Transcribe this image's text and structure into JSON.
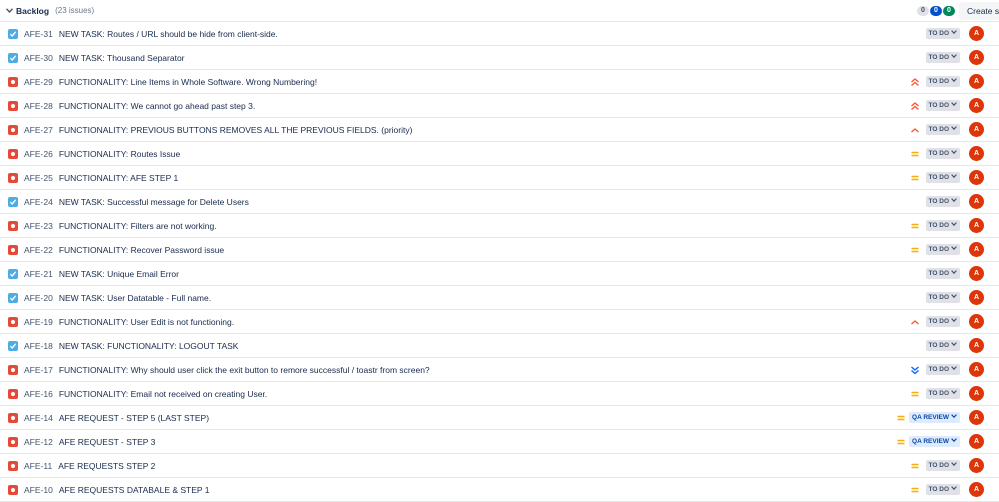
{
  "backlog": {
    "title": "Backlog",
    "count": "(23 issues)",
    "pills": [
      "0",
      "0",
      "0"
    ],
    "create_label": "Create sprint"
  },
  "colors": {
    "task": "#4bade8",
    "bug": "#e5493a",
    "priority_high": "#ff5630",
    "priority_medium": "#ffab00",
    "priority_low": "#0065ff",
    "avatar": "#de350b"
  },
  "issues": [
    {
      "type": "task",
      "key": "AFE-31",
      "summary": "NEW TASK: Routes / URL should be hide from client-side.",
      "priority": "none",
      "status": "TO DO",
      "avatar": "A"
    },
    {
      "type": "task",
      "key": "AFE-30",
      "summary": "NEW TASK: Thousand Separator",
      "priority": "none",
      "status": "TO DO",
      "avatar": "A"
    },
    {
      "type": "bug",
      "key": "AFE-29",
      "summary": "FUNCTIONALITY: Line Items in Whole Software. Wrong Numbering!",
      "priority": "highest",
      "status": "TO DO",
      "avatar": "A"
    },
    {
      "type": "bug",
      "key": "AFE-28",
      "summary": "FUNCTIONALITY: We cannot go ahead past step 3.",
      "priority": "highest",
      "status": "TO DO",
      "avatar": "A"
    },
    {
      "type": "bug",
      "key": "AFE-27",
      "summary": "FUNCTIONALITY: PREVIOUS BUTTONS REMOVES ALL THE PREVIOUS FIELDS. (priority)",
      "priority": "high",
      "status": "TO DO",
      "avatar": "A"
    },
    {
      "type": "bug",
      "key": "AFE-26",
      "summary": "FUNCTIONALITY: Routes Issue",
      "priority": "medium",
      "status": "TO DO",
      "avatar": "A"
    },
    {
      "type": "bug",
      "key": "AFE-25",
      "summary": "FUNCTIONALITY: AFE STEP 1",
      "priority": "medium",
      "status": "TO DO",
      "avatar": "A"
    },
    {
      "type": "task",
      "key": "AFE-24",
      "summary": "NEW TASK: Successful message for Delete Users",
      "priority": "none",
      "status": "TO DO",
      "avatar": "A"
    },
    {
      "type": "bug",
      "key": "AFE-23",
      "summary": "FUNCTIONALITY: Filters are not working.",
      "priority": "medium",
      "status": "TO DO",
      "avatar": "A"
    },
    {
      "type": "bug",
      "key": "AFE-22",
      "summary": "FUNCTIONALITY: Recover Password issue",
      "priority": "medium",
      "status": "TO DO",
      "avatar": "A"
    },
    {
      "type": "task",
      "key": "AFE-21",
      "summary": "NEW TASK: Unique Email Error",
      "priority": "none",
      "status": "TO DO",
      "avatar": "A"
    },
    {
      "type": "task",
      "key": "AFE-20",
      "summary": "NEW TASK: User Datatable - Full name.",
      "priority": "none",
      "status": "TO DO",
      "avatar": "A"
    },
    {
      "type": "bug",
      "key": "AFE-19",
      "summary": "FUNCTIONALITY: User Edit is not functioning.",
      "priority": "high",
      "status": "TO DO",
      "avatar": "A"
    },
    {
      "type": "task",
      "key": "AFE-18",
      "summary": "NEW TASK: FUNCTIONALITY: LOGOUT TASK",
      "priority": "none",
      "status": "TO DO",
      "avatar": "A"
    },
    {
      "type": "bug",
      "key": "AFE-17",
      "summary": "FUNCTIONALITY: Why should user click the exit button to remore successful / toastr from screen?",
      "priority": "lowest",
      "status": "TO DO",
      "avatar": "A"
    },
    {
      "type": "bug",
      "key": "AFE-16",
      "summary": "FUNCTIONALITY: Email not received on creating User.",
      "priority": "medium",
      "status": "TO DO",
      "avatar": "A"
    },
    {
      "type": "bug",
      "key": "AFE-14",
      "summary": "AFE REQUEST - STEP 5 (LAST STEP)",
      "priority": "medium",
      "status": "QA REVIEW",
      "avatar": "A"
    },
    {
      "type": "bug",
      "key": "AFE-12",
      "summary": "AFE REQUEST - STEP 3",
      "priority": "medium",
      "status": "QA REVIEW",
      "avatar": "A"
    },
    {
      "type": "bug",
      "key": "AFE-11",
      "summary": "AFE REQUESTS STEP 2",
      "priority": "medium",
      "status": "TO DO",
      "avatar": "A"
    },
    {
      "type": "bug",
      "key": "AFE-10",
      "summary": "AFE REQUESTS DATABALE & STEP 1",
      "priority": "medium",
      "status": "TO DO",
      "avatar": "A"
    }
  ]
}
